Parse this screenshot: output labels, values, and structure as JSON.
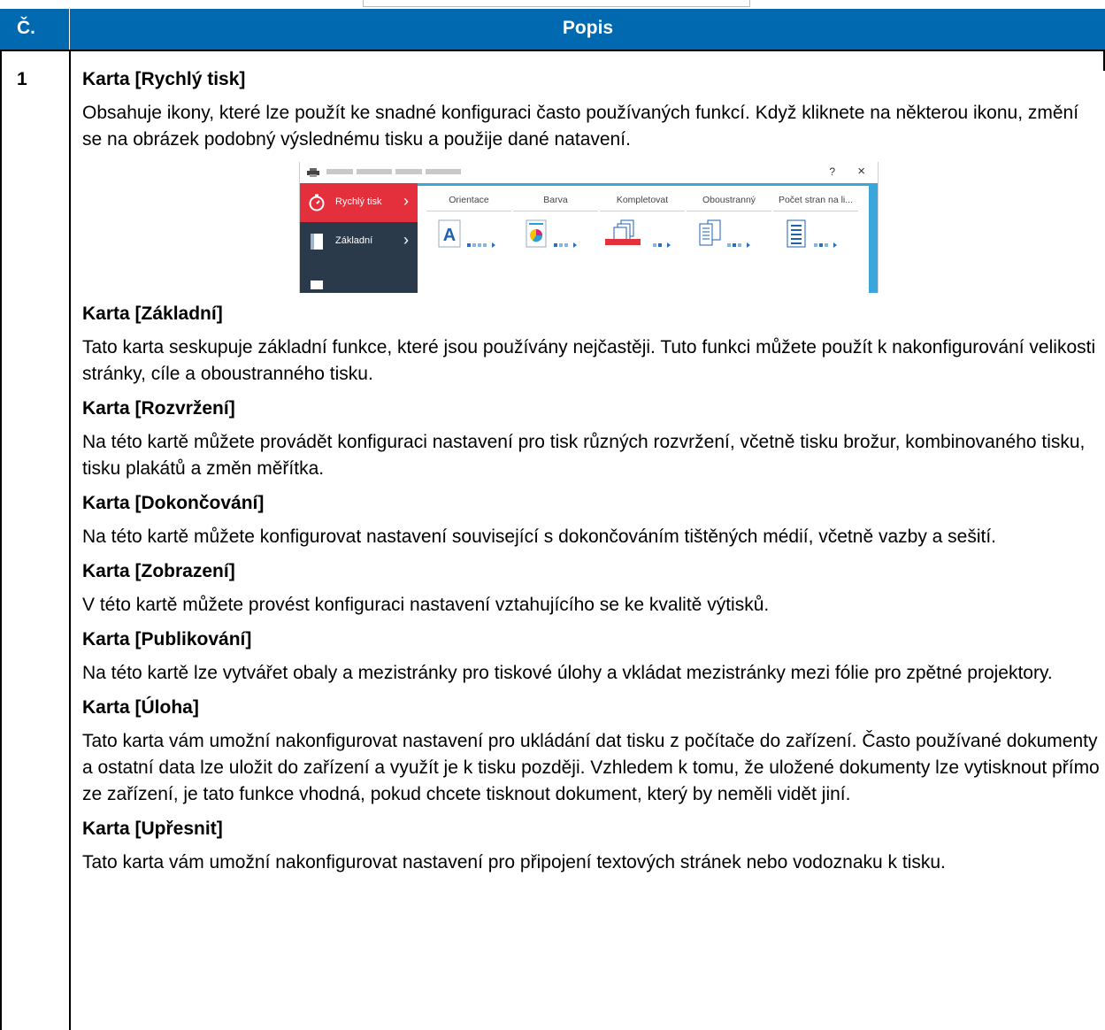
{
  "table": {
    "header_number": "Č.",
    "header_description": "Popis",
    "row_number": "1"
  },
  "sections": [
    {
      "title": "Karta [Rychlý tisk]",
      "body": "Obsahuje ikony, které lze použít ke snadné konfiguraci často používaných funkcí. Když kliknete na některou ikonu, změní se na obrázek podobný výslednému tisku a použije dané natavení."
    },
    {
      "title": "Karta [Základní]",
      "body": "Tato karta seskupuje základní funkce, které jsou používány nejčastěji. Tuto funkci můžete použít k nakonfigurování velikosti stránky, cíle a oboustranného tisku."
    },
    {
      "title": "Karta [Rozvržení]",
      "body": "Na této kartě můžete provádět konfiguraci nastavení pro tisk různých rozvržení, včetně tisku brožur, kombinovaného tisku, tisku plakátů a změn měřítka."
    },
    {
      "title": "Karta [Dokončování]",
      "body": "Na této kartě můžete konfigurovat nastavení související s dokončováním tištěných médií, včetně vazby a sešití."
    },
    {
      "title": "Karta [Zobrazení]",
      "body": "V této kartě můžete provést konfiguraci nastavení vztahujícího se ke kvalitě výtisků."
    },
    {
      "title": "Karta [Publikování]",
      "body": "Na této kartě lze vytvářet obaly a mezistránky pro tiskové úlohy a vkládat mezistránky mezi fólie pro zpětné projektory."
    },
    {
      "title": "Karta [Úloha]",
      "body": "Tato karta vám umožní nakonfigurovat nastavení pro ukládání dat tisku z počítače do zařízení. Často používané dokumenty a ostatní data lze uložit do zařízení a využít je k tisku později. Vzhledem k tomu, že uložené dokumenty lze vytisknout přímo ze zařízení, je tato funkce vhodná, pokud chcete tisknout dokument, který by neměli vidět jiní."
    },
    {
      "title": "Karta [Upřesnit]",
      "body": "Tato karta vám umožní nakonfigurovat nastavení pro připojení textových stránek nebo vodoznaku k tisku."
    }
  ],
  "screenshot": {
    "help_glyph": "?",
    "close_glyph": "×",
    "sidebar": [
      {
        "label": "Rychlý tisk",
        "icon": "stopwatch-icon",
        "active": true
      },
      {
        "label": "Základní",
        "icon": "page-icon",
        "active": false
      }
    ],
    "quick_print_columns": [
      {
        "label": "Orientace",
        "icon": "orientation-icon"
      },
      {
        "label": "Barva",
        "icon": "color-icon"
      },
      {
        "label": "Kompletovat",
        "icon": "collate-icon"
      },
      {
        "label": "Oboustranný",
        "icon": "duplex-icon"
      },
      {
        "label": "Počet stran na li...",
        "icon": "pages-per-sheet-icon"
      }
    ],
    "colors": {
      "active_tab": "#e4303d",
      "sidebar": "#2b3a4a",
      "accent": "#3aa6dc",
      "header": "#0069b0"
    }
  }
}
